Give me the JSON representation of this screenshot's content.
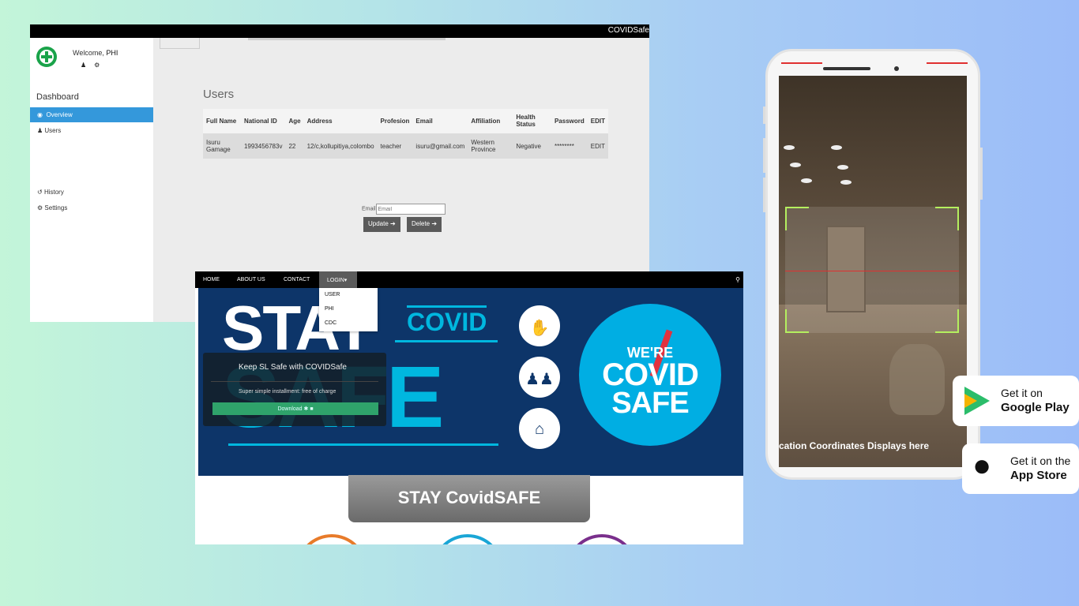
{
  "admin": {
    "brand": "COVIDSafe",
    "welcome_prefix": "Welcome,",
    "welcome_user": "PHI",
    "user_icon": "user-icon",
    "gear_icon": "gear-icon",
    "dashboard_title": "Dashboard",
    "nav": {
      "overview": "Overview",
      "users": "Users",
      "history": "History",
      "settings": "Settings"
    },
    "nav_icons": {
      "overview": "eye-icon",
      "users": "user-icon",
      "history": "history-icon",
      "settings": "gear-icon"
    },
    "accent": "#3498db",
    "users_heading": "Users",
    "table": {
      "headers": [
        "Full Name",
        "National ID",
        "Age",
        "Address",
        "Profesion",
        "Email",
        "Affiliation",
        "Health Status",
        "Password",
        "EDIT"
      ],
      "rows": [
        [
          "Isuru Gamage",
          "1993456783v",
          "22",
          "12/c,kollupitiya,colombo",
          "teacher",
          "isuru@gmail.com",
          "Western Province",
          "Negative",
          "********",
          "EDIT"
        ]
      ]
    },
    "email_label": "Email",
    "email_placeholder": "Email",
    "update_button": "Update ➔",
    "delete_button": "Delete ➔"
  },
  "site": {
    "nav": {
      "home": "HOME",
      "about": "ABOUT US",
      "contact": "CONTACT",
      "login": "LOGIN▾"
    },
    "search_icon": "search-icon",
    "login_menu": [
      "USER",
      "PHI",
      "CDC"
    ],
    "hero": {
      "stay": "STAY",
      "covid": "COVID",
      "safe": "SAFE",
      "badge_line1": "WE'RE",
      "badge_line2": "COVID",
      "badge_line3": "SAFE"
    },
    "promo": {
      "heading": "Keep SL Safe with COVIDSafe",
      "sub": "Super simple installment: free of charge",
      "download": "Download ✱  ■"
    },
    "banner": "STAY CovidSAFE",
    "hero_bg": "#0d3569",
    "hero_accent": "#00b7df"
  },
  "phone": {
    "coords_text": "cation Coordinates Displays here",
    "scan_color": "#b4ef5f"
  },
  "stores": {
    "google_top": "Get it on",
    "google_bottom": "Google Play",
    "apple_top": "Get it on the",
    "apple_bottom": "App Store"
  }
}
